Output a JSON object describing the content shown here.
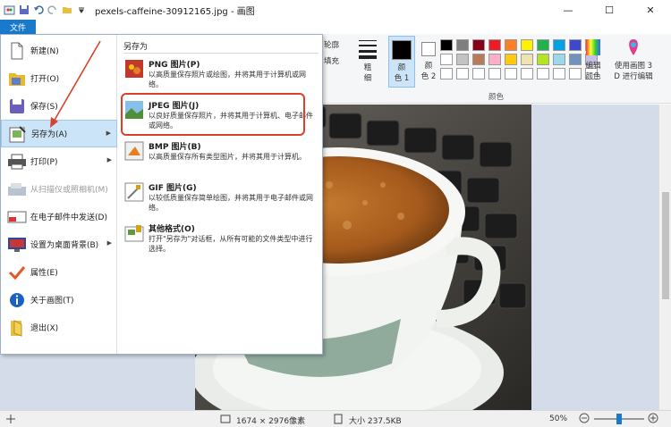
{
  "window": {
    "title": "pexels-caffeine-30912165.jpg - 画图",
    "minimize": "—",
    "maximize": "☐",
    "close": "✕"
  },
  "ribbon": {
    "file_tab": "文件",
    "outline_label": "轮廓",
    "fill_label": "填充",
    "size_label": "粗\n细",
    "color1_label": "颜\n色 1",
    "color2_label": "颜\n色 2",
    "edit_colors_label": "编辑\n颜色",
    "paint3d_label": "使用画图 3\nD 进行编辑",
    "colors_group_label": "颜色",
    "palette": [
      "#000000",
      "#7f7f7f",
      "#880015",
      "#ed1c24",
      "#ff7f27",
      "#fff200",
      "#22b14c",
      "#00a2e8",
      "#3f48cc",
      "#a349a4",
      "#ffffff",
      "#c3c3c3",
      "#b97a57",
      "#ffaec9",
      "#ffc90e",
      "#efe4b0",
      "#b5e61d",
      "#99d9ea",
      "#7092be",
      "#c8bfe7",
      "#ffffff",
      "#ffffff",
      "#ffffff",
      "#ffffff",
      "#ffffff",
      "#ffffff",
      "#ffffff",
      "#ffffff",
      "#ffffff",
      "#ffffff"
    ]
  },
  "file_menu": {
    "items": [
      {
        "label": "新建(N)",
        "icon": "new-file-icon"
      },
      {
        "label": "打开(O)",
        "icon": "open-folder-icon"
      },
      {
        "label": "保存(S)",
        "icon": "save-icon"
      },
      {
        "label": "另存为(A)",
        "icon": "save-as-icon"
      },
      {
        "label": "打印(P)",
        "icon": "printer-icon"
      },
      {
        "label": "从扫描仪或照相机(M)",
        "icon": "scanner-icon"
      },
      {
        "label": "在电子邮件中发送(D)",
        "icon": "email-icon"
      },
      {
        "label": "设置为桌面背景(B)",
        "icon": "desktop-icon"
      },
      {
        "label": "属性(E)",
        "icon": "checkmark-icon"
      },
      {
        "label": "关于画图(T)",
        "icon": "info-icon"
      },
      {
        "label": "退出(X)",
        "icon": "exit-icon"
      }
    ],
    "arrow": "▶",
    "save_as_header": "另存为",
    "options": [
      {
        "title": "PNG 图片(P)",
        "desc": "以高质量保存照片或绘图，并将其用于计算机或网络。",
        "icon": "png-icon"
      },
      {
        "title": "JPEG 图片(J)",
        "desc": "以良好质量保存照片，并将其用于计算机、电子邮件或网络。",
        "icon": "jpeg-icon"
      },
      {
        "title": "BMP 图片(B)",
        "desc": "以高质量保存所有类型图片，并将其用于计算机。",
        "icon": "bmp-icon"
      },
      {
        "title": "GIF 图片(G)",
        "desc": "以较低质量保存简单绘图，并将其用于电子邮件或网络。",
        "icon": "gif-icon"
      },
      {
        "title": "其他格式(O)",
        "desc": "打开\"另存为\"对话框，从所有可能的文件类型中进行选择。",
        "icon": "other-formats-icon"
      }
    ]
  },
  "status": {
    "dimensions": "1674 × 2976像素",
    "size": "大小 237.5KB",
    "zoom": "50%"
  }
}
